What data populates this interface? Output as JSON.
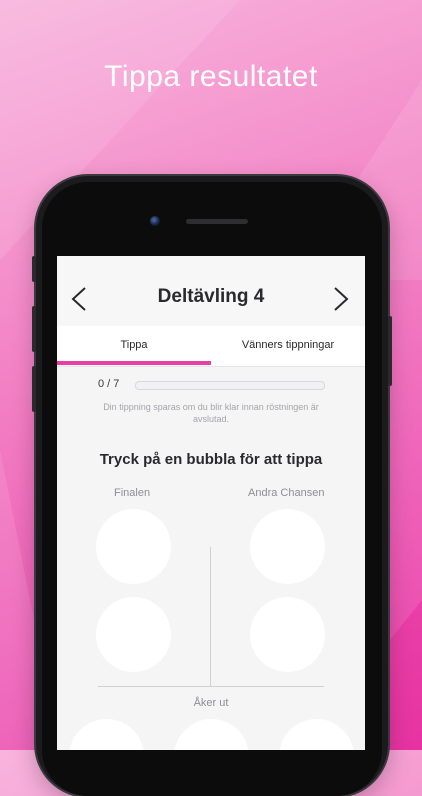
{
  "headline": "Tippa resultatet",
  "nav": {
    "title": "Deltävling 4"
  },
  "tabs": [
    {
      "label": "Tippa",
      "active": true
    },
    {
      "label": "Vänners tippningar",
      "active": false
    }
  ],
  "progress": {
    "label": "0 / 7",
    "value": 0,
    "total": 7
  },
  "hint": "Din tippning sparas om du blir klar innan röstningen är avslutad.",
  "section_title": "Tryck på en bubbla för att tippa",
  "columns": {
    "left": "Finalen",
    "right": "Andra Chansen"
  },
  "aker_ut": "Åker ut",
  "colors": {
    "accent": "#e83ea6",
    "bubble": "#ffffff",
    "background": "#f27ec3"
  }
}
